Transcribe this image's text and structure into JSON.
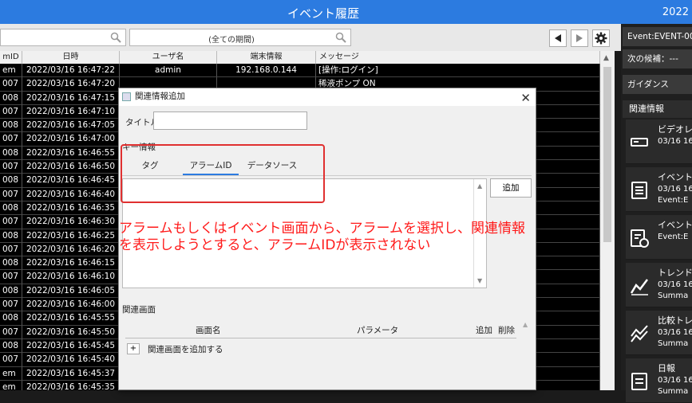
{
  "window": {
    "title": "イベント履歴",
    "year": "2022"
  },
  "toolbar": {
    "search_placeholder": "",
    "period_value": "(全ての期間)"
  },
  "table": {
    "columns": [
      "mID",
      "日時",
      "ユーザ名",
      "端末情報",
      "メッセージ"
    ],
    "rows": [
      {
        "id": "em",
        "datetime": "2022/03/16 16:47:22",
        "user": "admin",
        "terminal": "192.168.0.144",
        "message": "[操作:ログイン]"
      },
      {
        "id": "007",
        "datetime": "2022/03/16 16:47:20",
        "user": "",
        "terminal": "",
        "message": "稀液ポンプ ON"
      },
      {
        "id": "008",
        "datetime": "2022/03/16 16:47:15",
        "user": "",
        "terminal": "",
        "message": ""
      },
      {
        "id": "007",
        "datetime": "2022/03/16 16:47:10",
        "user": "",
        "terminal": "",
        "message": ""
      },
      {
        "id": "008",
        "datetime": "2022/03/16 16:47:05",
        "user": "",
        "terminal": "",
        "message": ""
      },
      {
        "id": "007",
        "datetime": "2022/03/16 16:47:00",
        "user": "",
        "terminal": "",
        "message": ""
      },
      {
        "id": "008",
        "datetime": "2022/03/16 16:46:55",
        "user": "",
        "terminal": "",
        "message": ""
      },
      {
        "id": "007",
        "datetime": "2022/03/16 16:46:50",
        "user": "",
        "terminal": "",
        "message": ""
      },
      {
        "id": "008",
        "datetime": "2022/03/16 16:46:45",
        "user": "",
        "terminal": "",
        "message": ""
      },
      {
        "id": "007",
        "datetime": "2022/03/16 16:46:40",
        "user": "",
        "terminal": "",
        "message": ""
      },
      {
        "id": "008",
        "datetime": "2022/03/16 16:46:35",
        "user": "",
        "terminal": "",
        "message": ""
      },
      {
        "id": "007",
        "datetime": "2022/03/16 16:46:30",
        "user": "",
        "terminal": "",
        "message": ""
      },
      {
        "id": "008",
        "datetime": "2022/03/16 16:46:25",
        "user": "",
        "terminal": "",
        "message": ""
      },
      {
        "id": "007",
        "datetime": "2022/03/16 16:46:20",
        "user": "",
        "terminal": "",
        "message": ""
      },
      {
        "id": "008",
        "datetime": "2022/03/16 16:46:15",
        "user": "",
        "terminal": "",
        "message": ""
      },
      {
        "id": "007",
        "datetime": "2022/03/16 16:46:10",
        "user": "",
        "terminal": "",
        "message": ""
      },
      {
        "id": "008",
        "datetime": "2022/03/16 16:46:05",
        "user": "",
        "terminal": "",
        "message": ""
      },
      {
        "id": "007",
        "datetime": "2022/03/16 16:46:00",
        "user": "",
        "terminal": "",
        "message": ""
      },
      {
        "id": "008",
        "datetime": "2022/03/16 16:45:55",
        "user": "",
        "terminal": "",
        "message": ""
      },
      {
        "id": "007",
        "datetime": "2022/03/16 16:45:50",
        "user": "",
        "terminal": "",
        "message": ""
      },
      {
        "id": "008",
        "datetime": "2022/03/16 16:45:45",
        "user": "",
        "terminal": "",
        "message": ""
      },
      {
        "id": "007",
        "datetime": "2022/03/16 16:45:40",
        "user": "",
        "terminal": "",
        "message": ""
      },
      {
        "id": "em",
        "datetime": "2022/03/16 16:45:37",
        "user": "",
        "terminal": "",
        "message": ""
      },
      {
        "id": "em",
        "datetime": "2022/03/16 16:45:35",
        "user": "",
        "terminal": "",
        "message": ""
      }
    ]
  },
  "right_panel": {
    "event_box": "Event:EVENT-00",
    "next_candidate": "次の候補：---",
    "guidance": "ガイダンス",
    "related_header": "関連情報",
    "items": [
      {
        "line1": "ビデオレコ",
        "line2": "03/16 16",
        "line3": "",
        "icon": "video-recorder-icon"
      },
      {
        "line1": "イベント履",
        "line2": "03/16 16",
        "line3": "Event:E",
        "icon": "list-icon"
      },
      {
        "line1": "イベントリ",
        "line2": "Event:E",
        "line3": "",
        "icon": "list-clock-icon"
      },
      {
        "line1": "トレンドグ",
        "line2": "03/16 16",
        "line3": "Summa",
        "icon": "trend-icon"
      },
      {
        "line1": "比較トレ",
        "line2": "03/16 16",
        "line3": "Summa",
        "icon": "compare-trend-icon"
      },
      {
        "line1": "日報",
        "line2": "03/16 16",
        "line3": "Summa",
        "icon": "report-icon"
      }
    ]
  },
  "dialog": {
    "title": "関連情報追加",
    "title_label": "タイトル",
    "title_value": "",
    "key_info_label": "キー情報",
    "tabs": [
      "タグ",
      "アラームID",
      "データソース"
    ],
    "active_tab": 1,
    "add_button": "追加",
    "related_screen_label": "関連画面",
    "columns": {
      "screen": "画面名",
      "param": "パラメータ",
      "add": "追加",
      "delete": "削除"
    },
    "add_screen_label": "関連画面を追加する",
    "plus_label": "+"
  },
  "annotation": {
    "line1": "アラームもしくはイベント画面から、アラームを選択し、関連情報",
    "line2": "を表示しようとすると、アラームIDが表示されない",
    "color": "#ff1a1a"
  },
  "colors": {
    "accent": "#2c7be0",
    "annotation": "#e03030"
  }
}
